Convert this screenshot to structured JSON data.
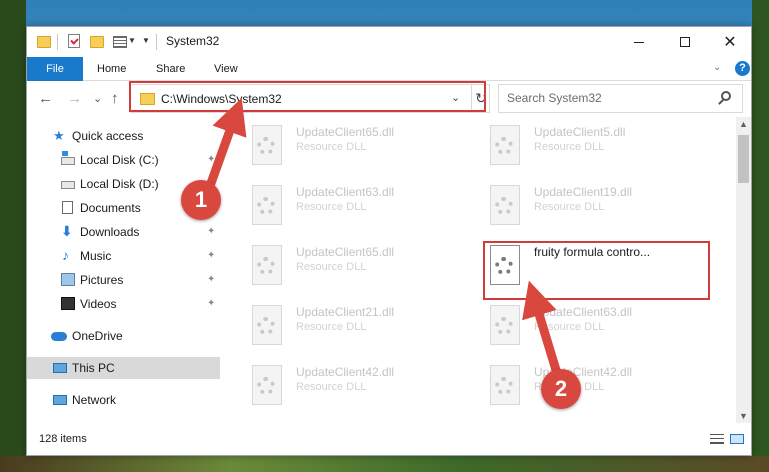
{
  "window": {
    "title": "System32",
    "controls": {
      "minimize": "",
      "maximize": "",
      "close": "✕"
    }
  },
  "ribbon": {
    "tabs": [
      "File",
      "Home",
      "Share",
      "View"
    ],
    "help_label": "?"
  },
  "address_bar": {
    "path": "C:\\Windows\\System32",
    "dropdown_glyph": "⌄",
    "refresh_glyph": "↻"
  },
  "search": {
    "placeholder": "Search System32"
  },
  "nav": {
    "back": "←",
    "forward": "→",
    "recent": "⌄",
    "up": "↑"
  },
  "sidebar": {
    "items": [
      {
        "label": "Quick access",
        "icon": "quick-access-star-icon",
        "pinned": false
      },
      {
        "label": "Local Disk (C:)",
        "icon": "drive-c-icon",
        "pinned": true
      },
      {
        "label": "Local Disk (D:)",
        "icon": "drive-d-icon",
        "pinned": true
      },
      {
        "label": "Documents",
        "icon": "documents-icon",
        "pinned": true
      },
      {
        "label": "Downloads",
        "icon": "downloads-icon",
        "pinned": true
      },
      {
        "label": "Music",
        "icon": "music-icon",
        "pinned": true
      },
      {
        "label": "Pictures",
        "icon": "pictures-icon",
        "pinned": true
      },
      {
        "label": "Videos",
        "icon": "videos-icon",
        "pinned": true
      },
      {
        "label": "OneDrive",
        "icon": "onedrive-icon",
        "pinned": false
      },
      {
        "label": "This PC",
        "icon": "this-pc-icon",
        "pinned": false,
        "selected": true
      },
      {
        "label": "Network",
        "icon": "network-icon",
        "pinned": false
      }
    ],
    "pin_glyph": "📌"
  },
  "files": [
    {
      "name": "UpdateClient65.dll",
      "type": "Resource DLL"
    },
    {
      "name": "UpdateClient5.dll",
      "type": "Resource DLL"
    },
    {
      "name": "UpdateClient63.dll",
      "type": "Resource DLL"
    },
    {
      "name": "UpdateClient19.dll",
      "type": "Resource DLL"
    },
    {
      "name": "UpdateClient65.dll",
      "type": "Resource DLL"
    },
    {
      "name": "fruity formula contro...",
      "type": "",
      "highlighted": true
    },
    {
      "name": "UpdateClient21.dll",
      "type": "Resource DLL"
    },
    {
      "name": "UpdateClient63.dll",
      "type": "Resource DLL"
    },
    {
      "name": "UpdateClient42.dll",
      "type": "Resource DLL"
    },
    {
      "name": "UpdateClient42.dll",
      "type": "Resource DLL"
    }
  ],
  "status_bar": {
    "item_count": "128 items"
  },
  "annotations": [
    {
      "number": "1"
    },
    {
      "number": "2"
    }
  ],
  "colors": {
    "accent": "#1979ca",
    "highlight": "#d33b3b",
    "badge": "#d9483f",
    "selected_nav": "#d9d9d9"
  }
}
